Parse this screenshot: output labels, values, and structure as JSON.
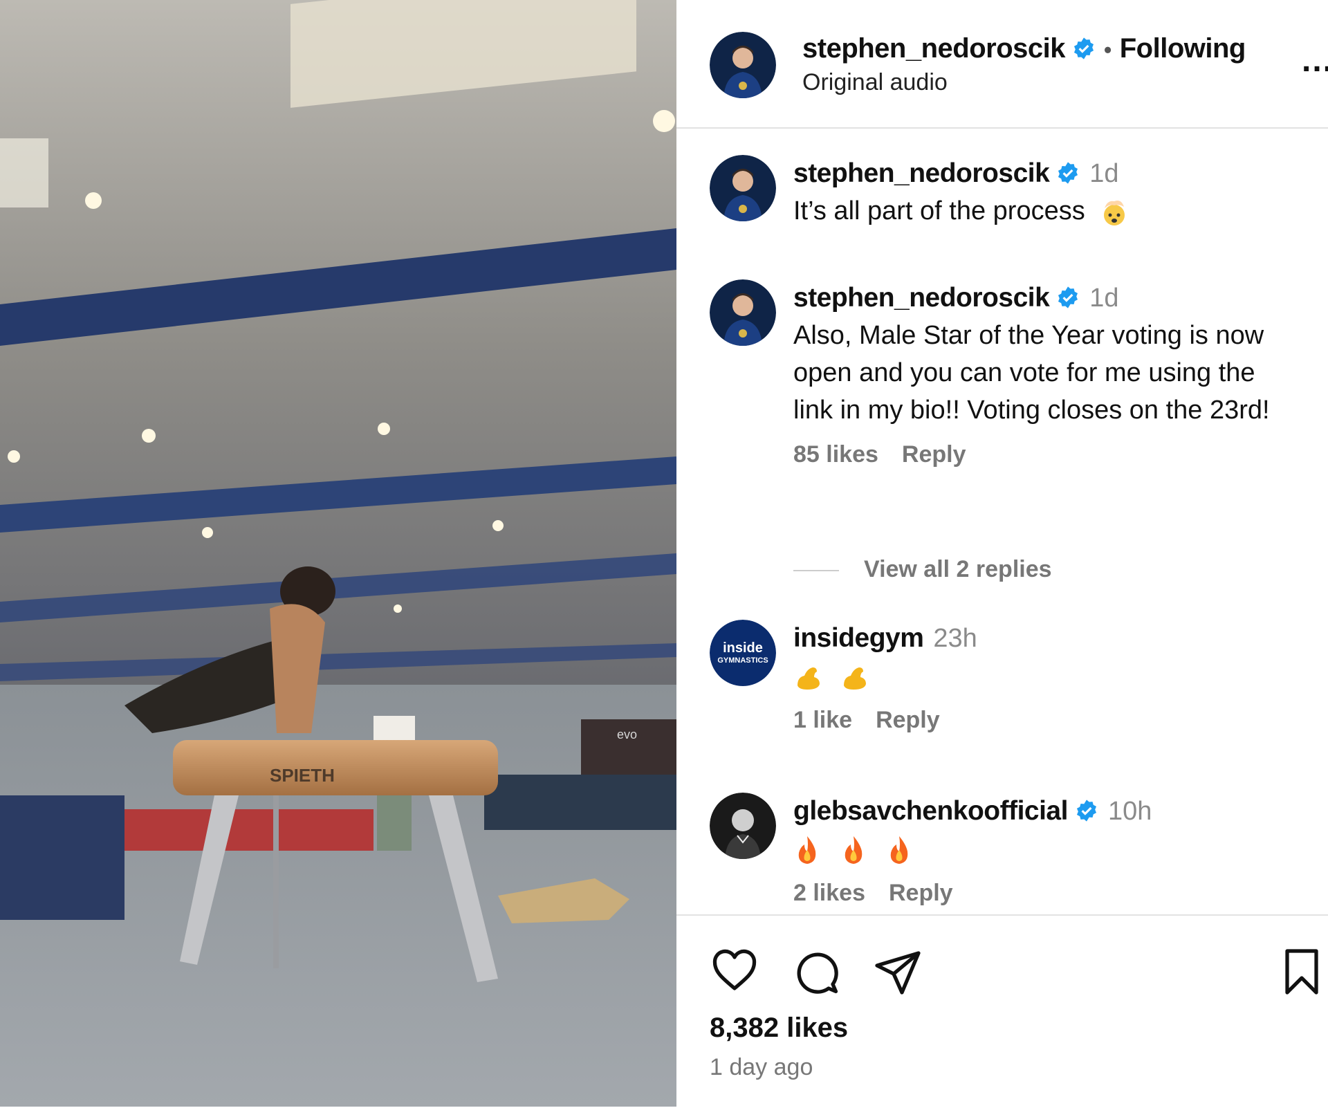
{
  "post": {
    "username": "stephen_nedoroscik",
    "follow_label": "Following",
    "audio": "Original audio",
    "more_label": "...",
    "likes": "8,382 likes",
    "posted": "1 day ago"
  },
  "media": {
    "brand_text": "SPIETH",
    "sign_text": "evo"
  },
  "comments": [
    {
      "username": "stephen_nedoroscik",
      "verified": true,
      "time": "1d",
      "text": "It’s all part of the process",
      "emoji": "exploding-head"
    },
    {
      "username": "stephen_nedoroscik",
      "verified": true,
      "time": "1d",
      "text": "Also, Male Star of the Year voting is now open and you can vote for me using the link in my bio!! Voting closes on the 23rd!",
      "likes": "85 likes",
      "reply": "Reply",
      "view_replies": "View all 2 replies"
    },
    {
      "username": "insidegym",
      "verified": false,
      "time": "23h",
      "emoji": "flexed-biceps x2",
      "likes": "1 like",
      "reply": "Reply",
      "avatar_top": "inside",
      "avatar_bottom": "GYMNASTICS"
    },
    {
      "username": "glebsavchenkoofficial",
      "verified": true,
      "time": "10h",
      "emoji": "fire x3",
      "likes": "2 likes",
      "reply": "Reply"
    }
  ],
  "colors": {
    "verified": "#1d9bf0",
    "muted": "#777777",
    "divider": "#e2e2e2",
    "insidegym": "#0b2c6e"
  }
}
